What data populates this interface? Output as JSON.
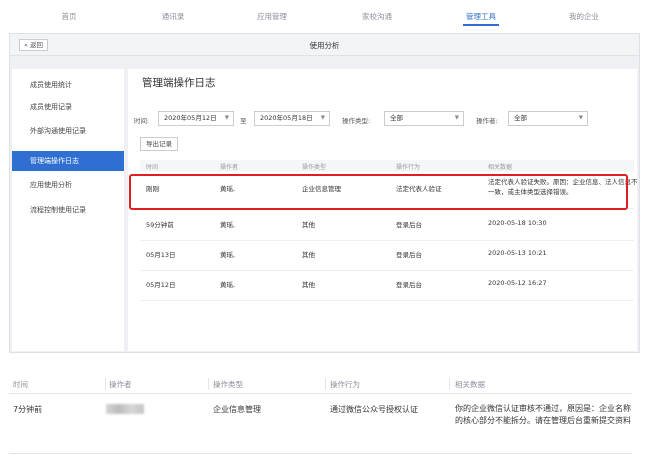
{
  "nav": {
    "items": [
      {
        "label": "首页"
      },
      {
        "label": "通讯录"
      },
      {
        "label": "应用管理"
      },
      {
        "label": "家校沟通"
      },
      {
        "label": "管理工具",
        "active": true
      },
      {
        "label": "我的企业"
      }
    ]
  },
  "subhead": {
    "back_label": "« 返回",
    "title": "使用分析"
  },
  "sidebar": {
    "items": [
      {
        "label": "成员使用统计"
      },
      {
        "label": "成员使用记录"
      },
      {
        "label": "外部沟通使用记录"
      },
      {
        "label": "管理端操作日志",
        "active": true
      },
      {
        "label": "应用使用分析"
      },
      {
        "label": "流程控制使用记录"
      }
    ]
  },
  "content": {
    "title": "管理端操作日志",
    "filters": {
      "time_label": "时间:",
      "start_date": "2020年05月12日",
      "to_label": "至",
      "end_date": "2020年05月18日",
      "op_type_label": "操作类型:",
      "op_type_value": "全部",
      "operator_label": "操作者:",
      "operator_value": "全部"
    },
    "export_label": "导出记录",
    "table": {
      "headers": [
        "时间",
        "操作者",
        "操作类型",
        "操作行为",
        "相关数据"
      ],
      "rows": [
        {
          "time": "刚刚",
          "operator": "黄瑶,",
          "type": "企业信息管理",
          "action": "法定代表人验证",
          "data": "法定代表人验证失败。原因：企业信息、法人信息不一致，或主体类型选择错误。"
        },
        {
          "time": "59分钟前",
          "operator": "黄瑶,",
          "type": "其他",
          "action": "登录后台",
          "data": "2020-05-18 10:30"
        },
        {
          "time": "05月13日",
          "operator": "黄瑶,",
          "type": "其他",
          "action": "登录后台",
          "data": "2020-05-13 10:21"
        },
        {
          "time": "05月12日",
          "operator": "黄瑶,",
          "type": "其他",
          "action": "登录后台",
          "data": "2020-05-12 16:27"
        }
      ]
    }
  },
  "zoom": {
    "headers": [
      "时间",
      "操作者",
      "操作类型",
      "操作行为",
      "相关数据"
    ],
    "row": {
      "time": "7分钟前",
      "type": "企业信息管理",
      "action": "通过微信公众号授权认证",
      "data": "你的企业微信认证审核不通过，原因是：企业名称的核心部分不能拆分。请在管理后台重新提交资料"
    }
  },
  "colors": {
    "accent": "#2f6fd1",
    "highlight": "#e02020"
  }
}
